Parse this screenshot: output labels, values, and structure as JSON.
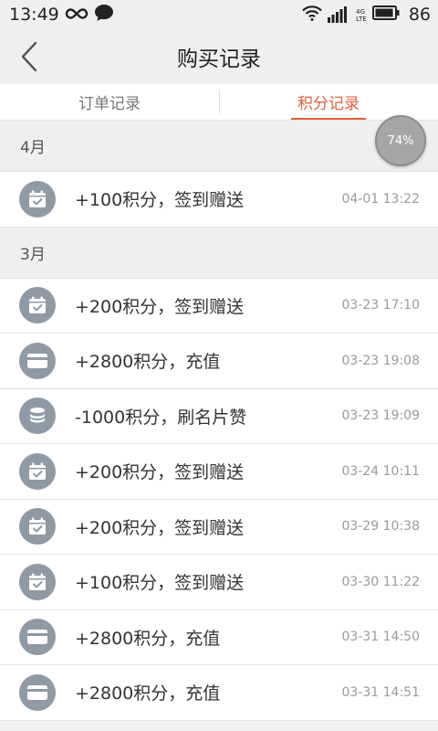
{
  "status_bar": {
    "time": "13:49",
    "network": "4G",
    "network_sub": "LTE",
    "battery": "86",
    "icons": [
      "infinity-icon",
      "chat-bubble-icon",
      "wifi-icon",
      "signal-icon",
      "battery-icon"
    ]
  },
  "header": {
    "title": "购买记录",
    "back_icon": "chevron-left-icon"
  },
  "tabs": [
    {
      "label": "订单记录",
      "active": false
    },
    {
      "label": "积分记录",
      "active": true
    }
  ],
  "progress_badge": "74%",
  "sections": [
    {
      "title": "4月",
      "records": [
        {
          "icon": "calendar-check-icon",
          "text": "+100积分，签到赠送",
          "time": "04-01 13:22"
        }
      ]
    },
    {
      "title": "3月",
      "records": [
        {
          "icon": "calendar-check-icon",
          "text": "+200积分，签到赠送",
          "time": "03-23 17:10"
        },
        {
          "icon": "credit-card-icon",
          "text": "+2800积分，充值",
          "time": "03-23 19:08"
        },
        {
          "icon": "coin-stack-icon",
          "text": "-1000积分，刷名片赞",
          "time": "03-23 19:09"
        },
        {
          "icon": "calendar-check-icon",
          "text": "+200积分，签到赠送",
          "time": "03-24 10:11"
        },
        {
          "icon": "calendar-check-icon",
          "text": "+200积分，签到赠送",
          "time": "03-29 10:38"
        },
        {
          "icon": "calendar-check-icon",
          "text": "+100积分，签到赠送",
          "time": "03-30 11:22"
        },
        {
          "icon": "credit-card-icon",
          "text": "+2800积分，充值",
          "time": "03-31 14:50"
        },
        {
          "icon": "credit-card-icon",
          "text": "+2800积分，充值",
          "time": "03-31 14:51"
        }
      ]
    }
  ],
  "colors": {
    "accent": "#e0603a",
    "icon_bg": "#8f9aa5",
    "section_bg": "#efefef"
  }
}
